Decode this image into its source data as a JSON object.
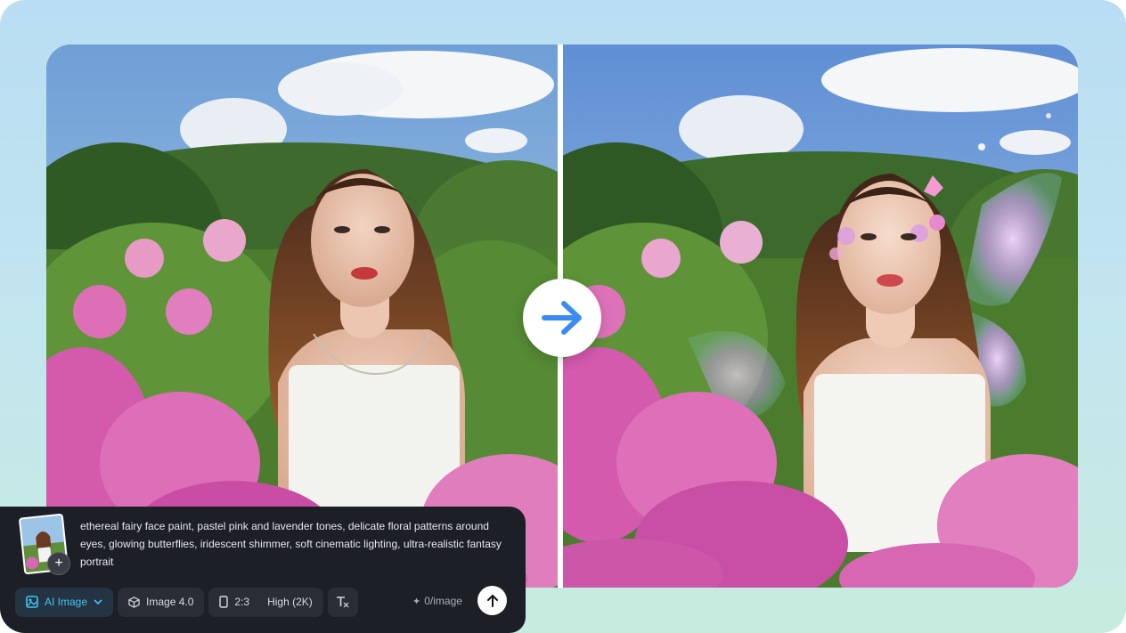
{
  "comparison": {
    "before_image": "portrait-among-pink-flowers",
    "after_image": "fairy-portrait-with-wings",
    "arrow_icon": "arrow-right-icon",
    "accent_color": "#3b8cf2"
  },
  "prompt": {
    "thumbnail_icon": "image-thumbnail",
    "add_icon": "plus-icon",
    "text": "ethereal fairy face paint, pastel pink and lavender tones, delicate floral patterns around eyes, glowing butterflies, iridescent shimmer, soft cinematic lighting, ultra-realistic fantasy portrait"
  },
  "toolbar": {
    "mode_label": "AI Image",
    "mode_color": "#3ec7f0",
    "model_label": "Image 4.0",
    "ratio_label": "2:3",
    "quality_label": "High (2K)",
    "credits_label": "0/image",
    "icons": [
      "ai-image-icon",
      "chevron-down-icon",
      "cube-icon",
      "phone-ratio-icon",
      "text-style-icon",
      "sparkle-icon",
      "arrow-up-icon"
    ]
  }
}
